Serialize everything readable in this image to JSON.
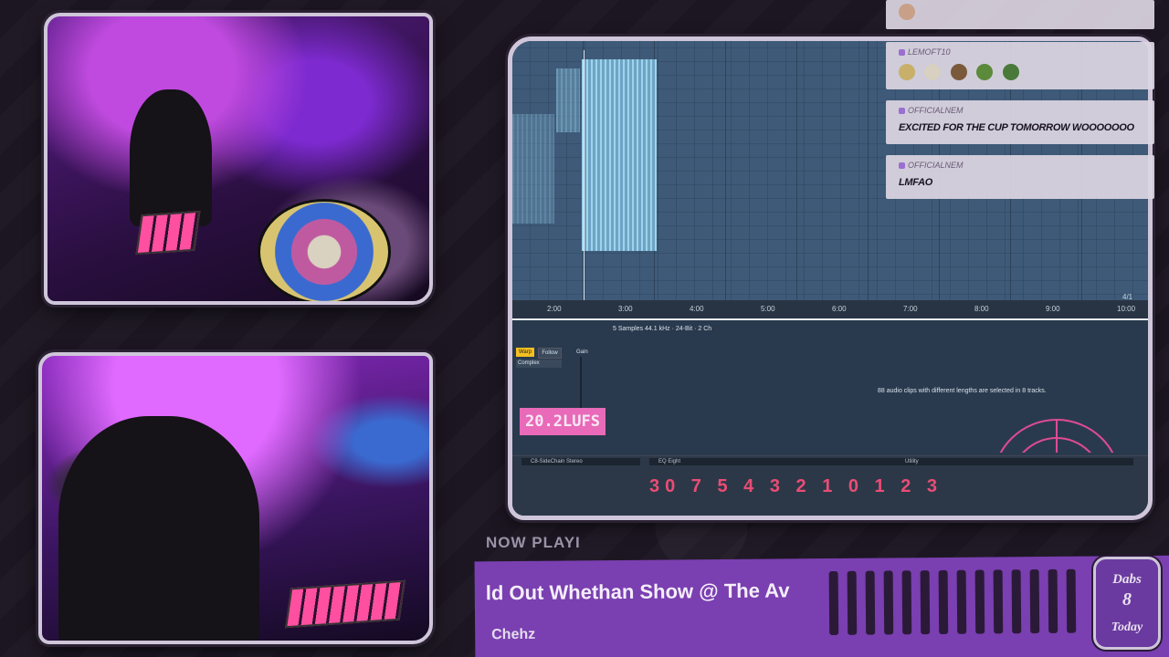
{
  "daw": {
    "ruler_marks": [
      "2:00",
      "3:00",
      "4:00",
      "5:00",
      "6:00",
      "7:00",
      "8:00",
      "9:00",
      "10:00"
    ],
    "time_signature": "4/1",
    "clip_info": "5 Samples  44.1 kHz · 24-Bit · 2 Ch",
    "warp_label": "Warp",
    "follow_label": "Follow",
    "warp_mode": "Complex",
    "gain_label": "Gain",
    "selection_message": "88 audio clips with different lengths are selected in 8 tracks.",
    "lufs_readout": "20.2LUFS",
    "device_sidechain": "C8-SideChain Stereo",
    "device_eq": "EQ Eight",
    "device_utility": "Utility",
    "device_digits": "30 7 5 4 3 2 1 0 1 2 3"
  },
  "chat": {
    "messages": [
      {
        "user": "",
        "text": ""
      },
      {
        "user": "LEMOFT10",
        "text": ""
      },
      {
        "user": "OFFICIALNEM",
        "text": "EXCITED FOR THE CUP TOMORROW WOOOOOOO"
      },
      {
        "user": "OFFICIALNEM",
        "text": "LMFAO"
      }
    ]
  },
  "now_playing": {
    "label": "NOW PLAYI",
    "title": "ld Out Whethan Show @ The Av",
    "artist": "Chehz"
  },
  "logo": {
    "line1": "Dabs",
    "line2": "8",
    "line3": "Today"
  }
}
